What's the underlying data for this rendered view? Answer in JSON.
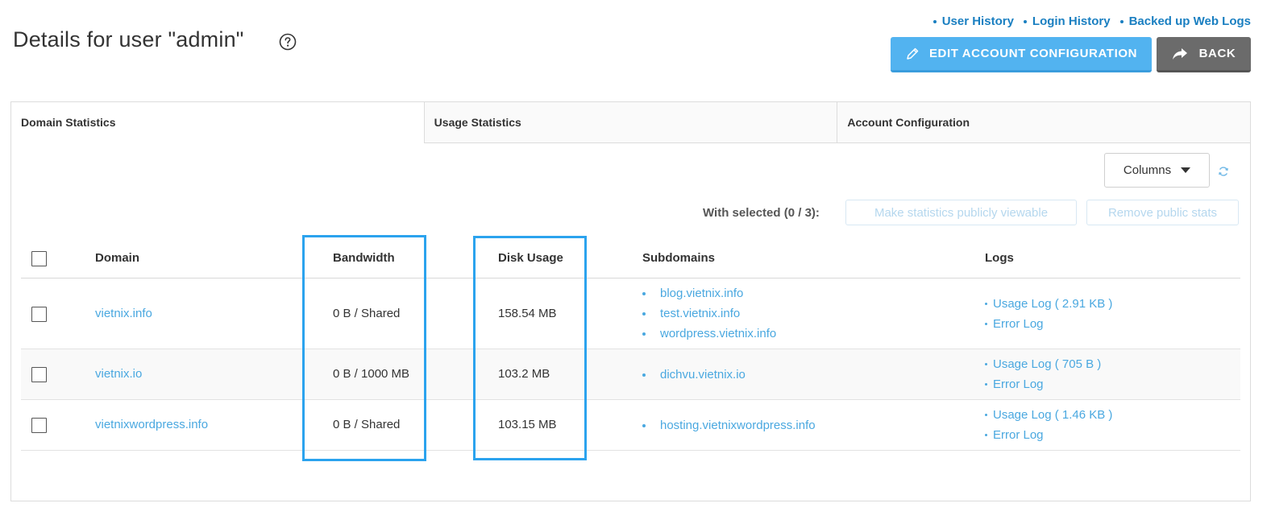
{
  "header": {
    "title": "Details for user \"admin\"",
    "links": [
      "User History",
      "Login History",
      "Backed up Web Logs"
    ],
    "edit_label": "EDIT ACCOUNT CONFIGURATION",
    "back_label": "BACK"
  },
  "tabs": [
    "Domain Statistics",
    "Usage Statistics",
    "Account Configuration"
  ],
  "toolbar": {
    "columns_label": "Columns",
    "with_selected": "With selected (0 / 3):",
    "make_public": "Make statistics publicly viewable",
    "remove_public": "Remove public stats"
  },
  "table": {
    "headers": [
      "Domain",
      "Bandwidth",
      "Disk Usage",
      "Subdomains",
      "Logs"
    ],
    "rows": [
      {
        "domain": "vietnix.info",
        "bandwidth": "0 B / Shared",
        "disk": "158.54 MB",
        "subdomains": [
          "blog.vietnix.info",
          "test.vietnix.info",
          "wordpress.vietnix.info"
        ],
        "usage_log": "Usage Log ( 2.91 KB )",
        "error_log": "Error Log"
      },
      {
        "domain": "vietnix.io",
        "bandwidth": "0 B / 1000 MB",
        "disk": "103.2 MB",
        "subdomains": [
          "dichvu.vietnix.io"
        ],
        "usage_log": "Usage Log ( 705 B )",
        "error_log": "Error Log"
      },
      {
        "domain": "vietnixwordpress.info",
        "bandwidth": "0 B / Shared",
        "disk": "103.15 MB",
        "subdomains": [
          "hosting.vietnixwordpress.info"
        ],
        "usage_log": "Usage Log ( 1.46 KB )",
        "error_log": "Error Log"
      }
    ]
  },
  "colors": {
    "accent": "#52b3f0",
    "link": "#4aa8e0",
    "highlight": "#2ba3ee",
    "back": "#6b6b6b"
  },
  "icons": [
    "help-circle-icon",
    "pencil-icon",
    "share-arrow-icon",
    "refresh-icon",
    "caret-down-icon"
  ]
}
